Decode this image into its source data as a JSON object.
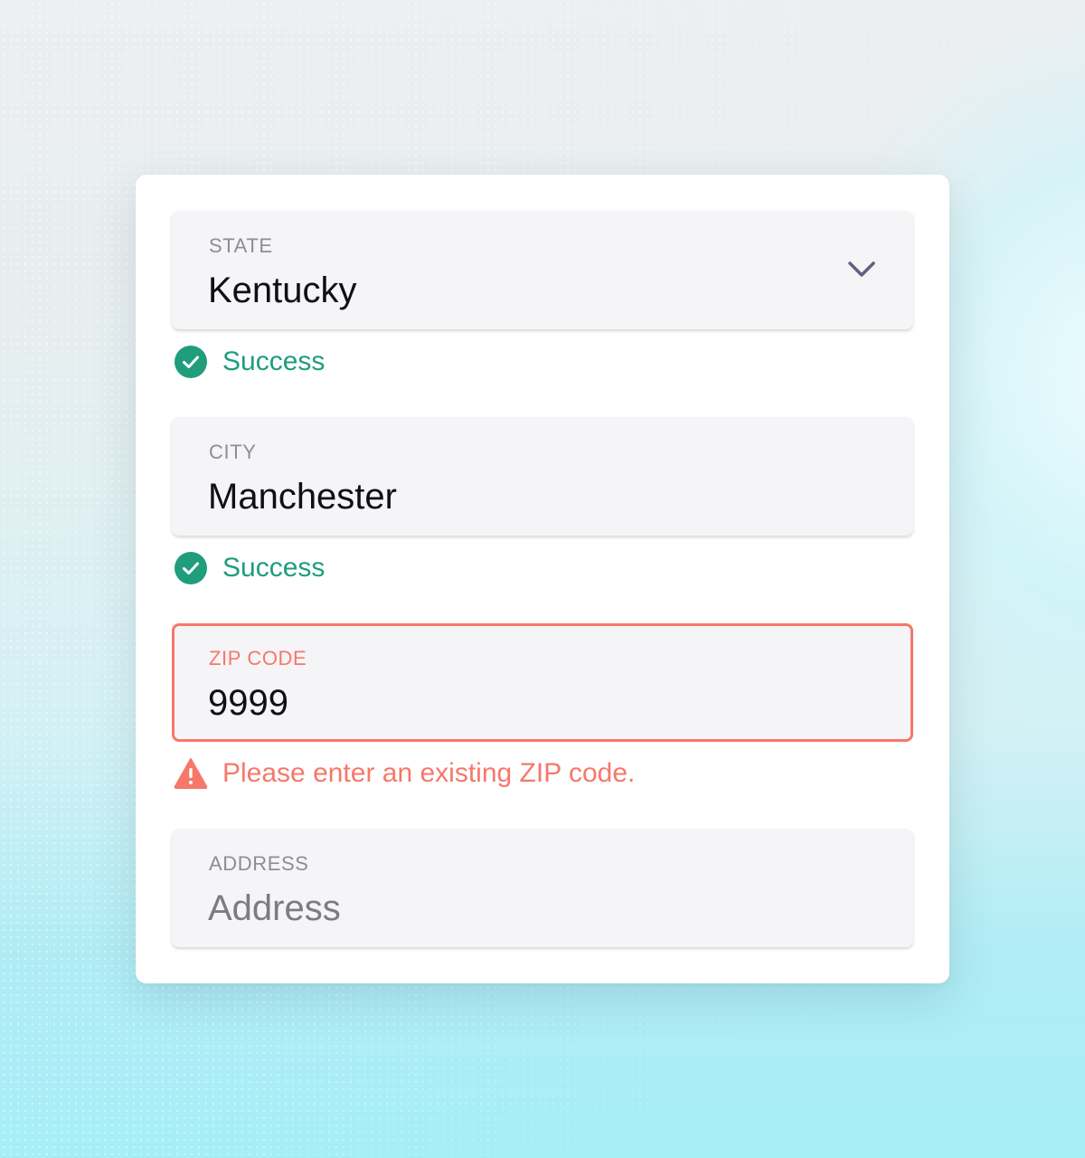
{
  "colors": {
    "success": "#1f9d7c",
    "error": "#f6786a",
    "field_bg": "#f5f4f6",
    "label": "#8e8d92",
    "chevron": "#5f6180"
  },
  "form": {
    "state": {
      "label": "STATE",
      "value": "Kentucky",
      "icon": "chevron-down-icon",
      "status_icon": "check-circle-icon",
      "status": "Success"
    },
    "city": {
      "label": "CITY",
      "value": "Manchester",
      "status_icon": "check-circle-icon",
      "status": "Success"
    },
    "zip": {
      "label": "ZIP CODE",
      "value": "9999",
      "status_icon": "warning-triangle-icon",
      "status": "Please enter an existing ZIP code."
    },
    "address": {
      "label": "ADDRESS",
      "placeholder": "Address"
    }
  }
}
